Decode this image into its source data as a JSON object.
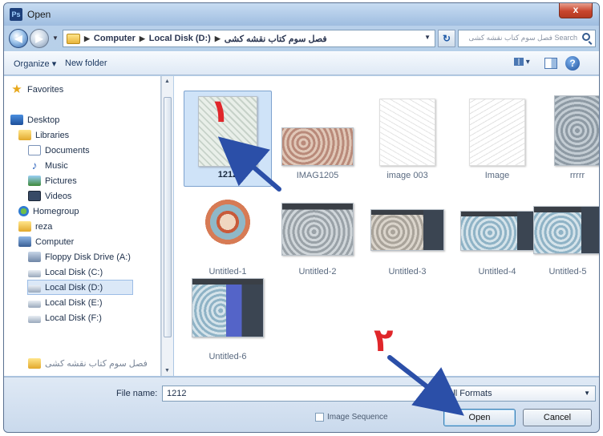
{
  "window": {
    "title": "Open",
    "app_badge": "Ps",
    "close_glyph": "x"
  },
  "address": {
    "segments": [
      "Computer",
      "Local Disk (D:)",
      "فصل سوم کتاب نقشه کشی"
    ],
    "search_placeholder": "Search فصل سوم کتاب نقشه کشی"
  },
  "toolbar": {
    "organize": "Organize ▾",
    "new_folder": "New folder"
  },
  "nav": {
    "favorites": "Favorites",
    "desktop": "Desktop",
    "libraries": "Libraries",
    "documents": "Documents",
    "music": "Music",
    "pictures": "Pictures",
    "videos": "Videos",
    "homegroup": "Homegroup",
    "user": "reza",
    "computer": "Computer",
    "floppy": "Floppy Disk Drive (A:)",
    "disk_c": "Local Disk (C:)",
    "disk_d": "Local Disk (D:)",
    "disk_e": "Local Disk (E:)",
    "disk_f": "Local Disk (F:)",
    "folder_partial": "فصل سوم کتاب نقشه کشی"
  },
  "files": [
    {
      "name": "1212"
    },
    {
      "name": "IMAG1205"
    },
    {
      "name": "image 003"
    },
    {
      "name": "Image"
    },
    {
      "name": "rrrrr"
    },
    {
      "name": "Untitled-1"
    },
    {
      "name": "Untitled-2"
    },
    {
      "name": "Untitled-3"
    },
    {
      "name": "Untitled-4"
    },
    {
      "name": "Untitled-5"
    },
    {
      "name": "Untitled-6"
    }
  ],
  "annotations": {
    "step1": "۱",
    "step2": "۲"
  },
  "bottom": {
    "file_name_label": "File name:",
    "file_name_value": "1212",
    "filter_value": "All Formats",
    "image_sequence_label": "Image Sequence",
    "open_label": "Open",
    "cancel_label": "Cancel"
  },
  "colors": {
    "accent_arrow": "#2b4fa8",
    "marker_red": "#e0262a",
    "selection": "#cfe3f8"
  }
}
